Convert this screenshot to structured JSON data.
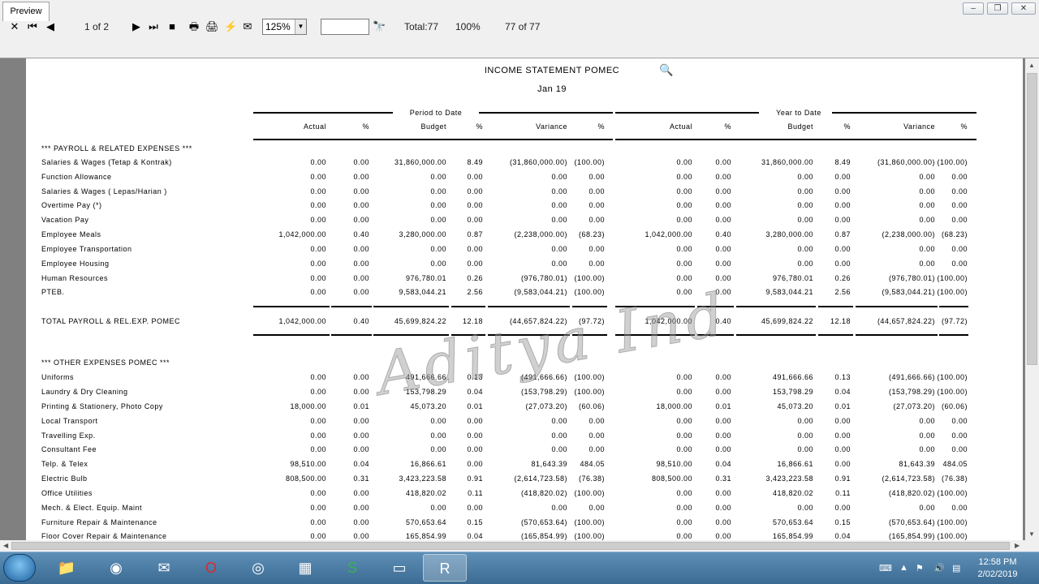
{
  "toolbar": {
    "page_indicator": "1 of 2",
    "zoom": "125%",
    "total": "Total:77",
    "percent": "100%",
    "count": "77 of 77"
  },
  "tabs": {
    "preview": "Preview"
  },
  "report": {
    "title": "INCOME STATEMENT POMEC",
    "period": "Jan 19",
    "group_ptd": "Period to Date",
    "group_ytd": "Year to Date",
    "col_headers": [
      "Actual",
      "%",
      "Budget",
      "%",
      "Variance",
      "%",
      "Actual",
      "%",
      "Budget",
      "%",
      "Variance",
      "%"
    ],
    "section1": "*** PAYROLL & RELATED EXPENSES ***",
    "payroll_rows": [
      {
        "label": "Salaries & Wages (Tetap & Kontrak)",
        "v": [
          "0.00",
          "0.00",
          "31,860,000.00",
          "8.49",
          "(31,860,000.00)",
          "(100.00)",
          "0.00",
          "0.00",
          "31,860,000.00",
          "8.49",
          "(31,860,000.00)",
          "(100.00)"
        ]
      },
      {
        "label": "Function Allowance",
        "v": [
          "0.00",
          "0.00",
          "0.00",
          "0.00",
          "0.00",
          "0.00",
          "0.00",
          "0.00",
          "0.00",
          "0.00",
          "0.00",
          "0.00"
        ]
      },
      {
        "label": "Salaries & Wages ( Lepas/Harian )",
        "v": [
          "0.00",
          "0.00",
          "0.00",
          "0.00",
          "0.00",
          "0.00",
          "0.00",
          "0.00",
          "0.00",
          "0.00",
          "0.00",
          "0.00"
        ]
      },
      {
        "label": "Overtime Pay (*)",
        "v": [
          "0.00",
          "0.00",
          "0.00",
          "0.00",
          "0.00",
          "0.00",
          "0.00",
          "0.00",
          "0.00",
          "0.00",
          "0.00",
          "0.00"
        ]
      },
      {
        "label": "Vacation Pay",
        "v": [
          "0.00",
          "0.00",
          "0.00",
          "0.00",
          "0.00",
          "0.00",
          "0.00",
          "0.00",
          "0.00",
          "0.00",
          "0.00",
          "0.00"
        ]
      },
      {
        "label": "Employee Meals",
        "v": [
          "1,042,000.00",
          "0.40",
          "3,280,000.00",
          "0.87",
          "(2,238,000.00)",
          "(68.23)",
          "1,042,000.00",
          "0.40",
          "3,280,000.00",
          "0.87",
          "(2,238,000.00)",
          "(68.23)"
        ]
      },
      {
        "label": "Employee Transportation",
        "v": [
          "0.00",
          "0.00",
          "0.00",
          "0.00",
          "0.00",
          "0.00",
          "0.00",
          "0.00",
          "0.00",
          "0.00",
          "0.00",
          "0.00"
        ]
      },
      {
        "label": "Employee Housing",
        "v": [
          "0.00",
          "0.00",
          "0.00",
          "0.00",
          "0.00",
          "0.00",
          "0.00",
          "0.00",
          "0.00",
          "0.00",
          "0.00",
          "0.00"
        ]
      },
      {
        "label": "Human Resources",
        "v": [
          "0.00",
          "0.00",
          "976,780.01",
          "0.26",
          "(976,780.01)",
          "(100.00)",
          "0.00",
          "0.00",
          "976,780.01",
          "0.26",
          "(976,780.01)",
          "(100.00)"
        ]
      },
      {
        "label": "PTEB.",
        "v": [
          "0.00",
          "0.00",
          "9,583,044.21",
          "2.56",
          "(9,583,044.21)",
          "(100.00)",
          "0.00",
          "0.00",
          "9,583,044.21",
          "2.56",
          "(9,583,044.21)",
          "(100.00)"
        ]
      }
    ],
    "total_row": {
      "label": "TOTAL PAYROLL & REL.EXP. POMEC",
      "v": [
        "1,042,000.00",
        "0.40",
        "45,699,824.22",
        "12.18",
        "(44,657,824.22)",
        "(97.72)",
        "1,042,000.00",
        "0.40",
        "45,699,824.22",
        "12.18",
        "(44,657,824.22)",
        "(97.72)"
      ]
    },
    "section2": "*** OTHER EXPENSES POMEC ***",
    "other_rows": [
      {
        "label": "Uniforms",
        "v": [
          "0.00",
          "0.00",
          "491,666.66",
          "0.13",
          "(491,666.66)",
          "(100.00)",
          "0.00",
          "0.00",
          "491,666.66",
          "0.13",
          "(491,666.66)",
          "(100.00)"
        ]
      },
      {
        "label": "Laundry & Dry Cleaning",
        "v": [
          "0.00",
          "0.00",
          "153,798.29",
          "0.04",
          "(153,798.29)",
          "(100.00)",
          "0.00",
          "0.00",
          "153,798.29",
          "0.04",
          "(153,798.29)",
          "(100.00)"
        ]
      },
      {
        "label": "Printing & Stationery, Photo Copy",
        "v": [
          "18,000.00",
          "0.01",
          "45,073.20",
          "0.01",
          "(27,073.20)",
          "(60.06)",
          "18,000.00",
          "0.01",
          "45,073.20",
          "0.01",
          "(27,073.20)",
          "(60.06)"
        ]
      },
      {
        "label": "Local Transport",
        "v": [
          "0.00",
          "0.00",
          "0.00",
          "0.00",
          "0.00",
          "0.00",
          "0.00",
          "0.00",
          "0.00",
          "0.00",
          "0.00",
          "0.00"
        ]
      },
      {
        "label": "Travelling Exp.",
        "v": [
          "0.00",
          "0.00",
          "0.00",
          "0.00",
          "0.00",
          "0.00",
          "0.00",
          "0.00",
          "0.00",
          "0.00",
          "0.00",
          "0.00"
        ]
      },
      {
        "label": "Consultant Fee",
        "v": [
          "0.00",
          "0.00",
          "0.00",
          "0.00",
          "0.00",
          "0.00",
          "0.00",
          "0.00",
          "0.00",
          "0.00",
          "0.00",
          "0.00"
        ]
      },
      {
        "label": "Telp. & Telex",
        "v": [
          "98,510.00",
          "0.04",
          "16,866.61",
          "0.00",
          "81,643.39",
          "484.05",
          "98,510.00",
          "0.04",
          "16,866.61",
          "0.00",
          "81,643.39",
          "484.05"
        ]
      },
      {
        "label": "Electric Bulb",
        "v": [
          "808,500.00",
          "0.31",
          "3,423,223.58",
          "0.91",
          "(2,614,723.58)",
          "(76.38)",
          "808,500.00",
          "0.31",
          "3,423,223.58",
          "0.91",
          "(2,614,723.58)",
          "(76.38)"
        ]
      },
      {
        "label": "Office Utilities",
        "v": [
          "0.00",
          "0.00",
          "418,820.02",
          "0.11",
          "(418,820.02)",
          "(100.00)",
          "0.00",
          "0.00",
          "418,820.02",
          "0.11",
          "(418,820.02)",
          "(100.00)"
        ]
      },
      {
        "label": "Mech. & Elect. Equip. Maint",
        "v": [
          "0.00",
          "0.00",
          "0.00",
          "0.00",
          "0.00",
          "0.00",
          "0.00",
          "0.00",
          "0.00",
          "0.00",
          "0.00",
          "0.00"
        ]
      },
      {
        "label": "Furniture Repair & Maintenance",
        "v": [
          "0.00",
          "0.00",
          "570,653.64",
          "0.15",
          "(570,653.64)",
          "(100.00)",
          "0.00",
          "0.00",
          "570,653.64",
          "0.15",
          "(570,653.64)",
          "(100.00)"
        ]
      },
      {
        "label": "Floor Cover Repair & Maintenance",
        "v": [
          "0.00",
          "0.00",
          "165,854.99",
          "0.04",
          "(165,854.99)",
          "(100.00)",
          "0.00",
          "0.00",
          "165,854.99",
          "0.04",
          "(165,854.99)",
          "(100.00)"
        ]
      }
    ]
  },
  "watermark": "Aditya Ind",
  "clock": {
    "time": "12:58 PM",
    "date": "2/02/2019"
  }
}
